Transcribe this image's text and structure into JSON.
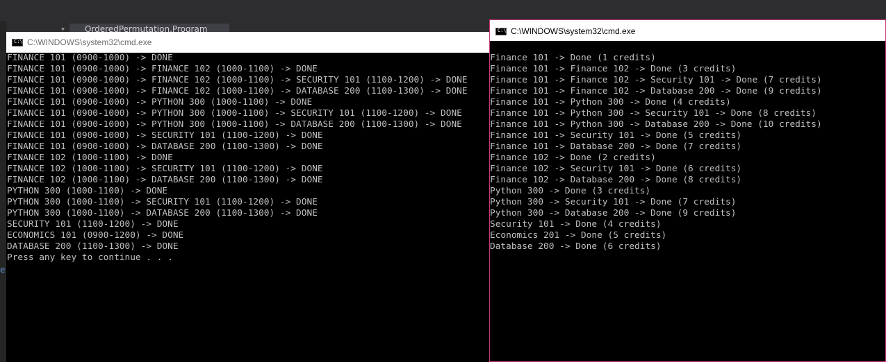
{
  "ide": {
    "tab_label": "OrderedPermutation.Program",
    "left_glyph": "e"
  },
  "console_left": {
    "title": "C:\\WINDOWS\\system32\\cmd.exe",
    "icon": "cmd-icon",
    "icon_text": "C:\\",
    "lines": [
      "FINANCE 101 (0900-1000) -> DONE",
      "FINANCE 101 (0900-1000) -> FINANCE 102 (1000-1100) -> DONE",
      "FINANCE 101 (0900-1000) -> FINANCE 102 (1000-1100) -> SECURITY 101 (1100-1200) -> DONE",
      "FINANCE 101 (0900-1000) -> FINANCE 102 (1000-1100) -> DATABASE 200 (1100-1300) -> DONE",
      "FINANCE 101 (0900-1000) -> PYTHON 300 (1000-1100) -> DONE",
      "FINANCE 101 (0900-1000) -> PYTHON 300 (1000-1100) -> SECURITY 101 (1100-1200) -> DONE",
      "FINANCE 101 (0900-1000) -> PYTHON 300 (1000-1100) -> DATABASE 200 (1100-1300) -> DONE",
      "FINANCE 101 (0900-1000) -> SECURITY 101 (1100-1200) -> DONE",
      "FINANCE 101 (0900-1000) -> DATABASE 200 (1100-1300) -> DONE",
      "FINANCE 102 (1000-1100) -> DONE",
      "FINANCE 102 (1000-1100) -> SECURITY 101 (1100-1200) -> DONE",
      "FINANCE 102 (1000-1100) -> DATABASE 200 (1100-1300) -> DONE",
      "PYTHON 300 (1000-1100) -> DONE",
      "PYTHON 300 (1000-1100) -> SECURITY 101 (1100-1200) -> DONE",
      "PYTHON 300 (1000-1100) -> DATABASE 200 (1100-1300) -> DONE",
      "SECURITY 101 (1100-1200) -> DONE",
      "ECONOMICS 101 (0900-1200) -> DONE",
      "DATABASE 200 (1100-1300) -> DONE",
      "Press any key to continue . . ."
    ]
  },
  "console_right": {
    "title": "C:\\WINDOWS\\system32\\cmd.exe",
    "icon": "cmd-icon",
    "icon_text": "C:\\",
    "lines": [
      "Finance 101 -> Done (1 credits)",
      "Finance 101 -> Finance 102 -> Done (3 credits)",
      "Finance 101 -> Finance 102 -> Security 101 -> Done (7 credits)",
      "Finance 101 -> Finance 102 -> Database 200 -> Done (9 credits)",
      "Finance 101 -> Python 300 -> Done (4 credits)",
      "Finance 101 -> Python 300 -> Security 101 -> Done (8 credits)",
      "Finance 101 -> Python 300 -> Database 200 -> Done (10 credits)",
      "Finance 101 -> Security 101 -> Done (5 credits)",
      "Finance 101 -> Database 200 -> Done (7 credits)",
      "Finance 102 -> Done (2 credits)",
      "Finance 102 -> Security 101 -> Done (6 credits)",
      "Finance 102 -> Database 200 -> Done (8 credits)",
      "Python 300 -> Done (3 credits)",
      "Python 300 -> Security 101 -> Done (7 credits)",
      "Python 300 -> Database 200 -> Done (9 credits)",
      "Security 101 -> Done (4 credits)",
      "Economics 201 -> Done (5 credits)",
      "Database 200 -> Done (6 credits)"
    ]
  },
  "colors": {
    "console_bg": "#000000",
    "console_text": "#c0c0c0",
    "active_border": "#c8367c",
    "ide_bg": "#2d2d30"
  }
}
